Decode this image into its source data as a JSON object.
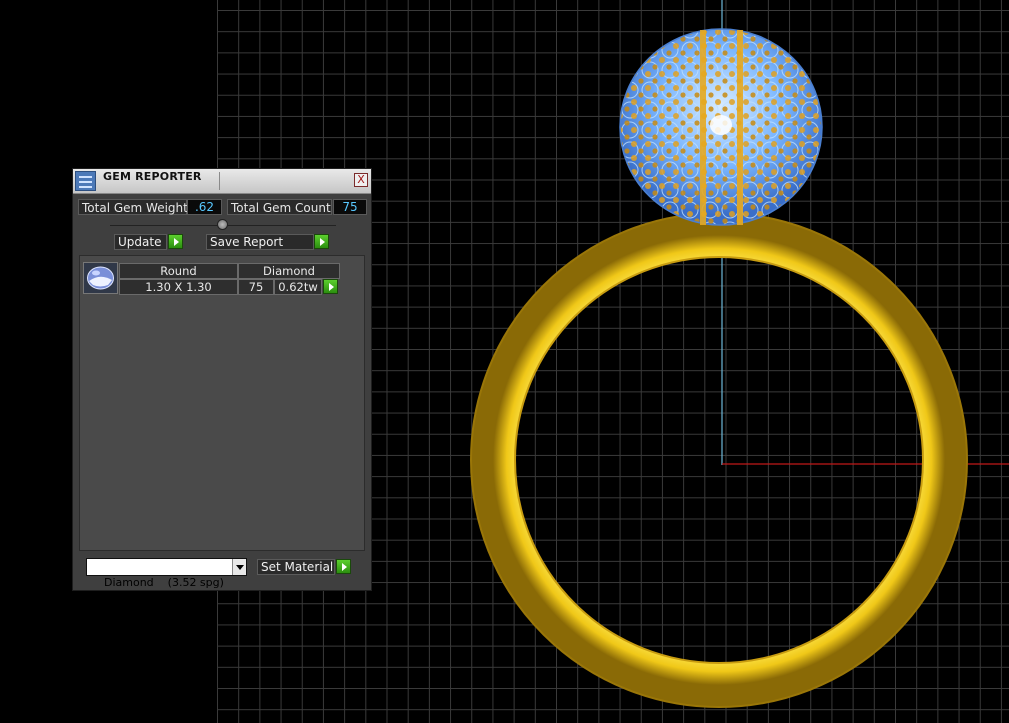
{
  "panel": {
    "title": "GEM REPORTER",
    "close_glyph": "X",
    "total_weight_label": "Total Gem Weight",
    "total_weight_value": ".62",
    "total_count_label": "Total Gem Count",
    "total_count_value": "75",
    "update_label": "Update",
    "save_report_label": "Save Report",
    "gem_rows": [
      {
        "shape": "Round",
        "material": "Diamond",
        "size": "1.30 X 1.30",
        "count": "75",
        "weight": "0.62tw",
        "thumb_icon": "round-gem-icon"
      }
    ],
    "material_select_value": "Diamond    (3.52 spg)",
    "set_material_label": "Set Material"
  },
  "viewport": {
    "object_icon": "gold-ring-with-gem-cluster",
    "metal_color": "#f2cc1c",
    "gem_color": "#7ab6ff",
    "prong_color": "#e0a020",
    "axis_y_color": "#6fb8d8",
    "axis_x_color": "#c01818"
  }
}
